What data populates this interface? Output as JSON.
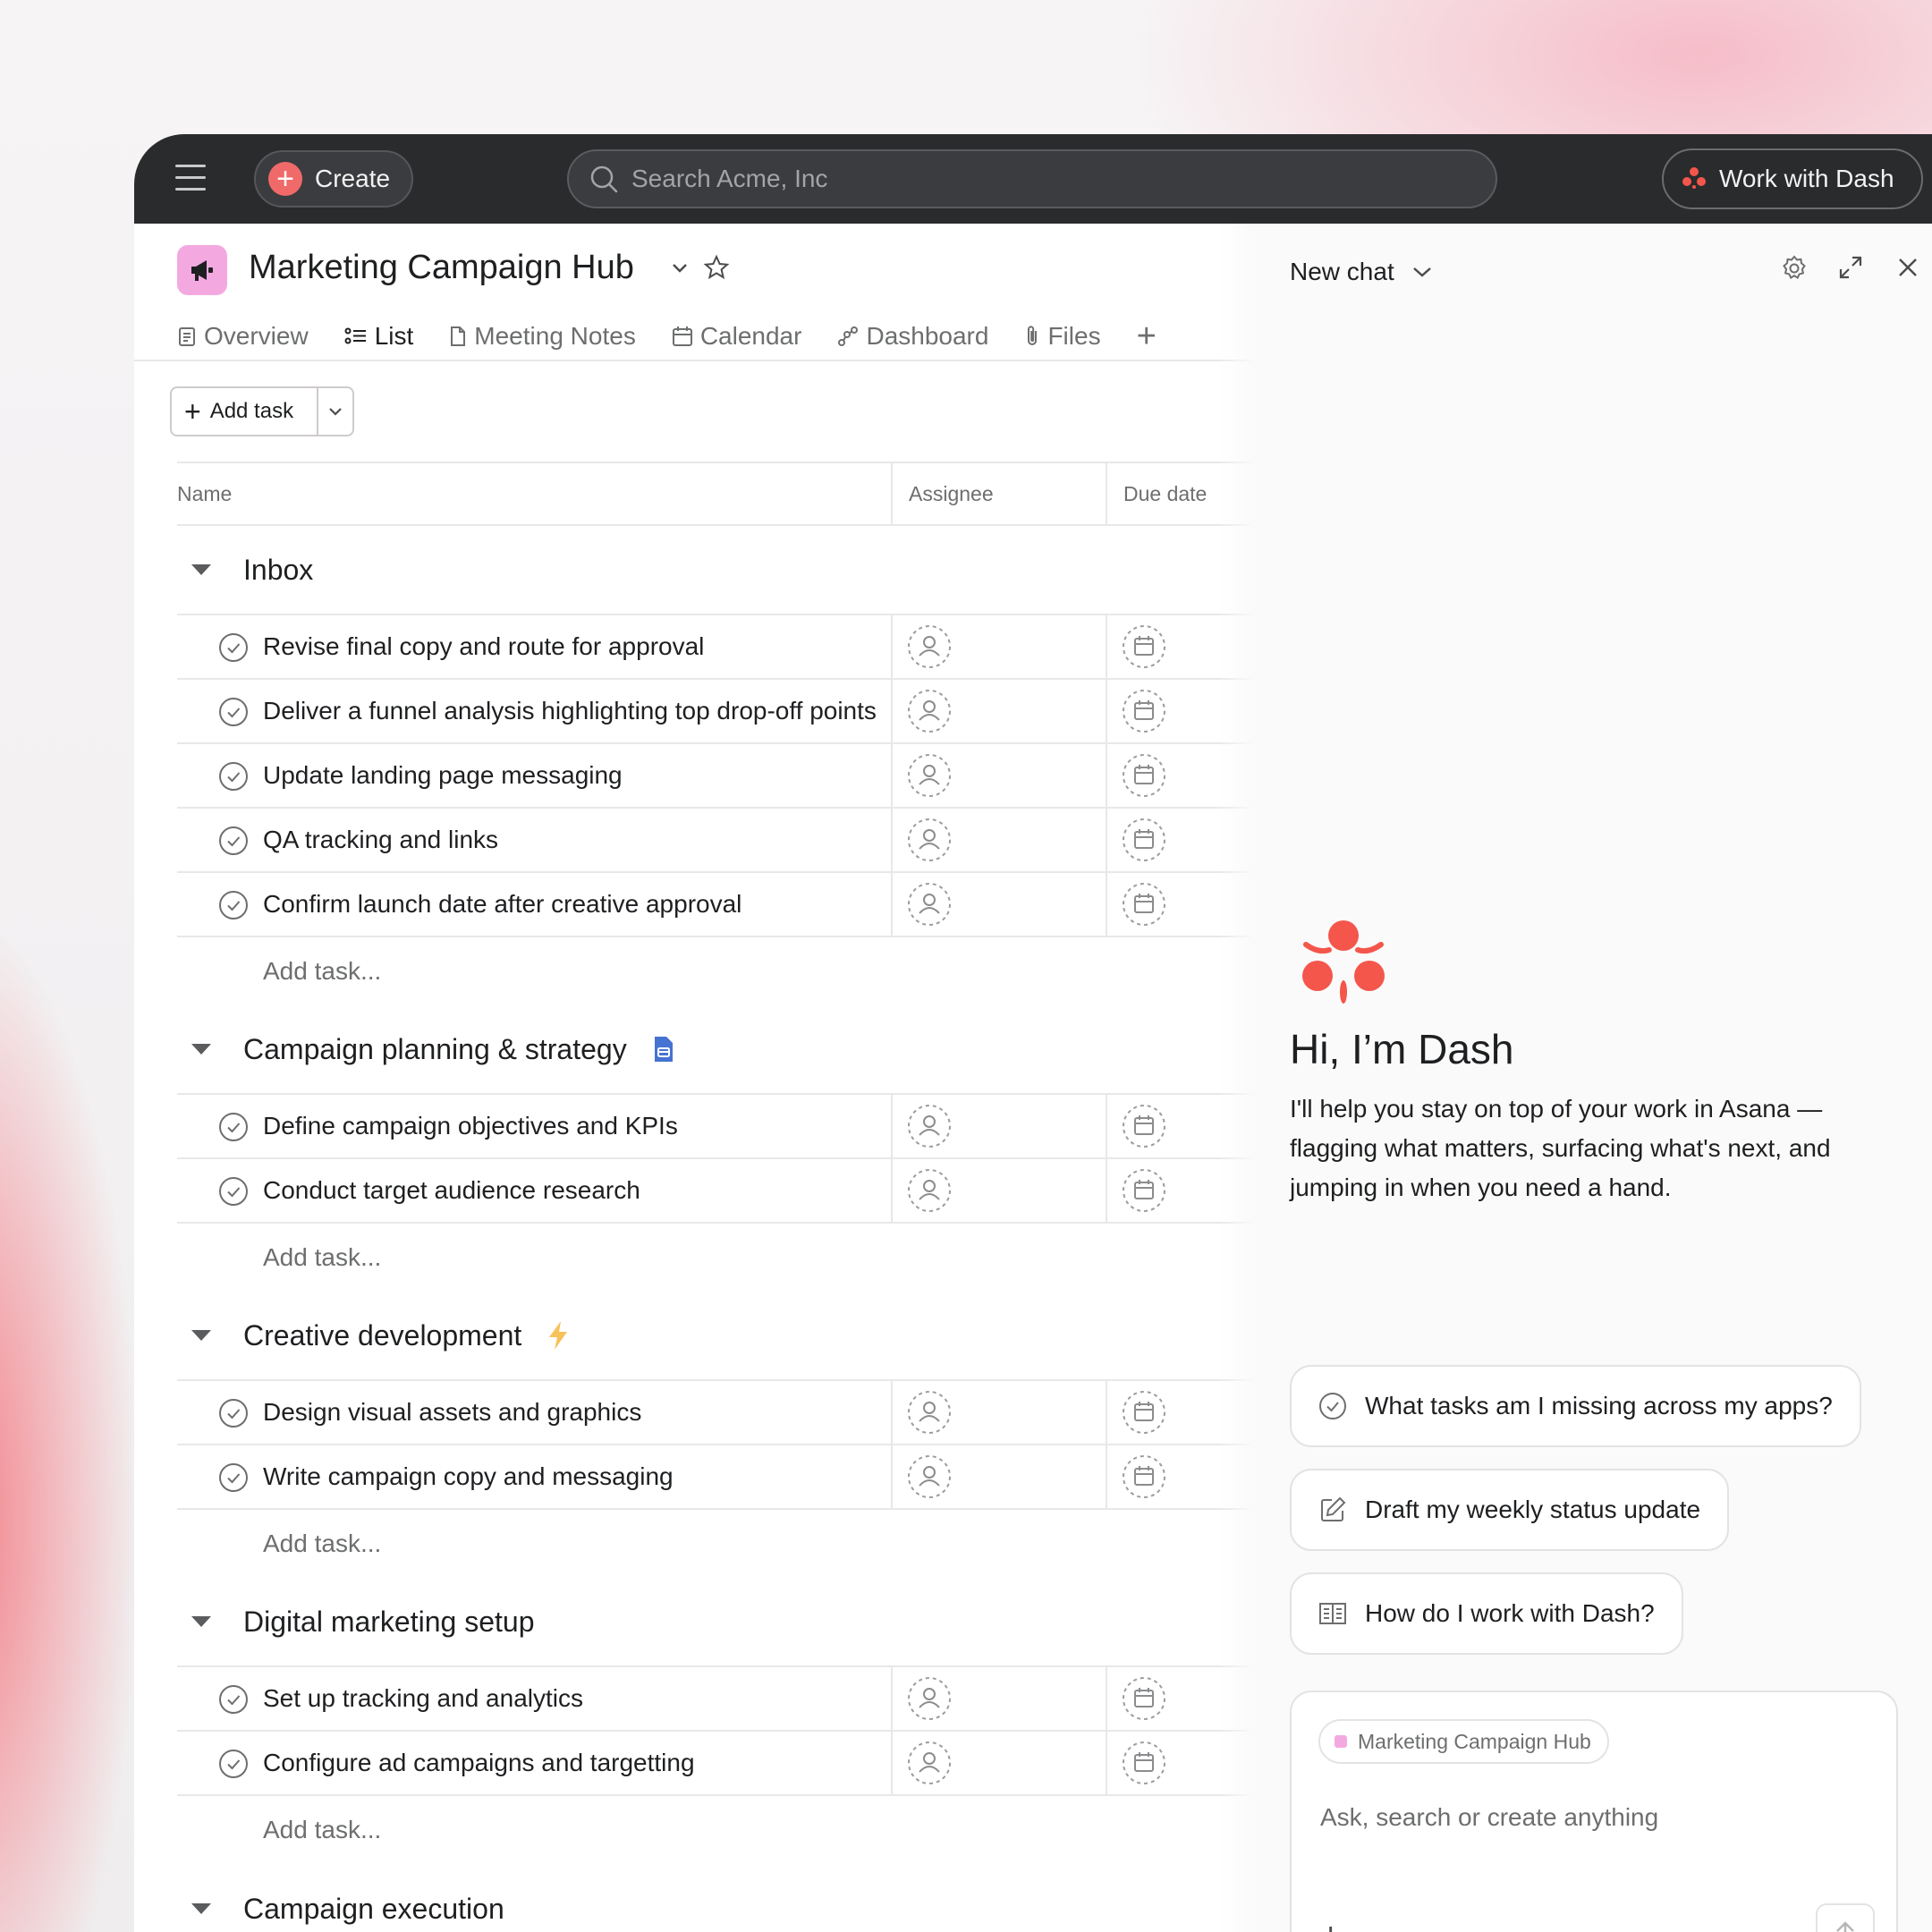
{
  "topbar": {
    "create_label": "Create",
    "search_placeholder": "Search Acme, Inc",
    "dash_button_label": "Work with Dash"
  },
  "project": {
    "title": "Marketing Campaign Hub",
    "icon": "megaphone-icon",
    "icon_color": "#f3a9e0"
  },
  "tabs": [
    {
      "label": "Overview",
      "icon": "overview-icon"
    },
    {
      "label": "List",
      "icon": "list-icon",
      "active": true
    },
    {
      "label": "Meeting Notes",
      "icon": "document-icon"
    },
    {
      "label": "Calendar",
      "icon": "calendar-icon"
    },
    {
      "label": "Dashboard",
      "icon": "dashboard-icon"
    },
    {
      "label": "Files",
      "icon": "paperclip-icon"
    }
  ],
  "toolbar": {
    "add_task_label": "Add task"
  },
  "columns": {
    "name": "Name",
    "assignee": "Assignee",
    "due": "Due date"
  },
  "add_task_placeholder": "Add task...",
  "sections": [
    {
      "title": "Inbox",
      "tasks": [
        "Revise final copy and route for approval",
        "Deliver a funnel analysis highlighting top drop-off points",
        "Update landing page messaging",
        "QA tracking and links",
        "Confirm launch date after creative approval"
      ]
    },
    {
      "title": "Campaign planning & strategy",
      "icon": "document-badge-icon",
      "tasks": [
        "Define campaign objectives and KPIs",
        "Conduct target audience research"
      ]
    },
    {
      "title": "Creative development",
      "icon": "lightning-icon",
      "tasks": [
        "Design visual assets and graphics",
        "Write campaign copy and messaging"
      ]
    },
    {
      "title": "Digital marketing setup",
      "tasks": [
        "Set up tracking and analytics",
        "Configure ad campaigns and targetting"
      ]
    },
    {
      "title": "Campaign execution",
      "tasks": []
    }
  ],
  "chat": {
    "title": "New chat",
    "greeting": "Hi, I’m Dash",
    "description": "I'll help you stay on top of your work in Asana — flagging what matters, surfacing what's next, and jumping in when you need a hand.",
    "suggestions": [
      {
        "label": "What tasks am I missing across my apps?",
        "icon": "check-circle-icon"
      },
      {
        "label": "Draft my weekly status update",
        "icon": "edit-icon"
      },
      {
        "label": "How do I work with Dash?",
        "icon": "book-icon"
      }
    ],
    "context_pill": "Marketing Campaign Hub",
    "input_placeholder": "Ask, search or create anything"
  },
  "colors": {
    "topbar": "#2a2b2d",
    "accent": "#f06a6a",
    "dash_red": "#f4564c"
  }
}
